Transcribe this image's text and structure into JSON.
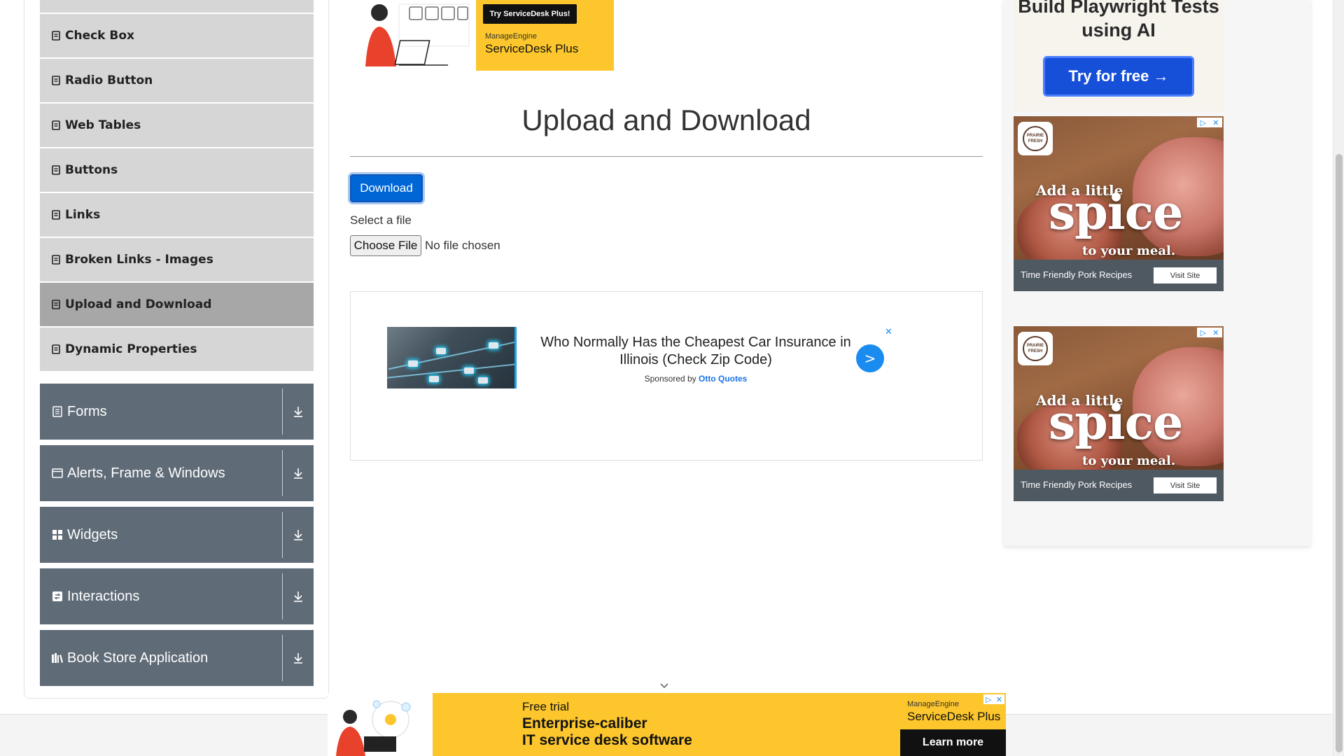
{
  "sidebar": {
    "items": [
      {
        "label": "Check Box",
        "active": false
      },
      {
        "label": "Radio Button",
        "active": false
      },
      {
        "label": "Web Tables",
        "active": false
      },
      {
        "label": "Buttons",
        "active": false
      },
      {
        "label": "Links",
        "active": false
      },
      {
        "label": "Broken Links - Images",
        "active": false
      },
      {
        "label": "Upload and Download",
        "active": true
      },
      {
        "label": "Dynamic Properties",
        "active": false
      }
    ],
    "groups": [
      {
        "label": "Forms",
        "icon": "form-icon"
      },
      {
        "label": "Alerts, Frame & Windows",
        "icon": "window-icon"
      },
      {
        "label": "Widgets",
        "icon": "widgets-icon"
      },
      {
        "label": "Interactions",
        "icon": "interactions-icon"
      },
      {
        "label": "Book Store Application",
        "icon": "books-icon"
      }
    ]
  },
  "top_ad": {
    "cta": "Try ServiceDesk Plus!",
    "brand_small": "ManageEngine",
    "brand_big": "ServiceDesk Plus"
  },
  "main": {
    "title": "Upload and Download",
    "download_label": "Download",
    "select_label": "Select a file",
    "choose_label": "Choose File",
    "no_file": "No file chosen"
  },
  "content_ad": {
    "headline": "Who Normally Has the Cheapest Car Insurance in Illinois (Check Zip Code)",
    "sponsored_prefix": "Sponsored by",
    "sponsor": "Otto Quotes",
    "go_label": ">",
    "close_label": "✕"
  },
  "right_ads": {
    "playwright": {
      "title": "Build Playwright Tests using AI",
      "cta": "Try for free →"
    },
    "pork": {
      "logo": "PRAIRIE FRESH",
      "line1": "Add a little",
      "line2": "spice",
      "line3": "to your meal.",
      "footer": "Time Friendly Pork Recipes",
      "visit": "Visit Site"
    }
  },
  "bottom_ad": {
    "free": "Free trial",
    "headline_1": "Enterprise-caliber",
    "headline_2": "IT service desk software",
    "brand_small": "ManageEngine",
    "brand_big": "ServiceDesk Plus",
    "cta": "Learn more"
  },
  "colors": {
    "group_bg": "#5f6b77",
    "menu_bg": "#d6d6d6",
    "menu_active_bg": "#a7a7a7",
    "primary": "#0066d6",
    "ad_yellow": "#fcc62c"
  }
}
